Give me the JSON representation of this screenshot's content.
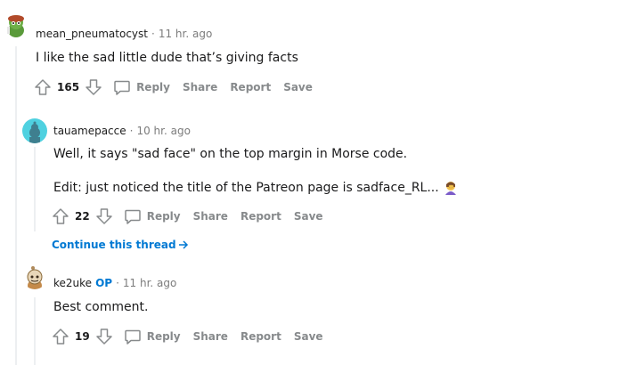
{
  "comments": [
    {
      "username": "mean_pneumatocyst",
      "op_badge": "",
      "time": "11 hr. ago",
      "body": [
        "I like the sad little dude that’s giving facts"
      ],
      "votes": "165",
      "actions": {
        "reply": "Reply",
        "share": "Share",
        "report": "Report",
        "save": "Save"
      }
    },
    {
      "username": "tauamepacce",
      "op_badge": "",
      "time": "10 hr. ago",
      "body": [
        "Well, it says \"sad face\" on the top margin in Morse code.",
        "Edit: just noticed the title of the Patreon page is sadface_RL..."
      ],
      "votes": "22",
      "actions": {
        "reply": "Reply",
        "share": "Share",
        "report": "Report",
        "save": "Save"
      }
    },
    {
      "username": "ke2uke",
      "op_badge": "OP",
      "time": "11 hr. ago",
      "body": [
        "Best comment."
      ],
      "votes": "19",
      "actions": {
        "reply": "Reply",
        "share": "Share",
        "report": "Report",
        "save": "Save"
      }
    }
  ],
  "continue_thread": "Continue this thread",
  "separator": "·",
  "colors": {
    "link": "#0079d3",
    "meta": "#7c7c7c",
    "action": "#878a8c",
    "thread_line": "#edeff1"
  }
}
